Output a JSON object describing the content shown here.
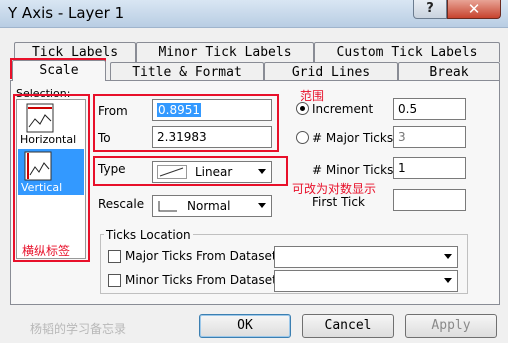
{
  "window": {
    "title": "Y Axis - Layer 1",
    "help": "?",
    "close": "✕"
  },
  "tabs_row1": [
    "Tick Labels",
    "Minor Tick Labels",
    "Custom Tick Labels"
  ],
  "tabs_row2": [
    "Scale",
    "Title & Format",
    "Grid Lines",
    "Break"
  ],
  "selection": {
    "label": "Selection:",
    "items": [
      "Horizontal",
      "Vertical"
    ],
    "selected": "Vertical"
  },
  "range": {
    "from_label": "From",
    "from_value": "0.8951",
    "to_label": "To",
    "to_value": "2.31983"
  },
  "type": {
    "label": "Type",
    "value": "Linear"
  },
  "rescale": {
    "label": "Rescale",
    "value": "Normal"
  },
  "increment": {
    "label": "Increment",
    "value": "0.5",
    "selected": true
  },
  "major_ticks": {
    "label": "# Major Ticks",
    "value": "3"
  },
  "minor_ticks": {
    "label": "# Minor Ticks",
    "value": "1"
  },
  "first_tick": {
    "label": "First Tick",
    "value": ""
  },
  "ticks_location": {
    "title": "Ticks Location",
    "major": "Major Ticks From Dataset",
    "minor": "Minor Ticks From Dataset"
  },
  "annotations": {
    "range_note": "范围",
    "log_note": "可改为对数显示",
    "axis_note": "横纵标签"
  },
  "watermark": "杨韬的学习备忘录",
  "buttons": {
    "ok": "OK",
    "cancel": "Cancel",
    "apply": "Apply"
  },
  "colors": {
    "annotation": "#e8102a",
    "selection": "#3399ff"
  }
}
